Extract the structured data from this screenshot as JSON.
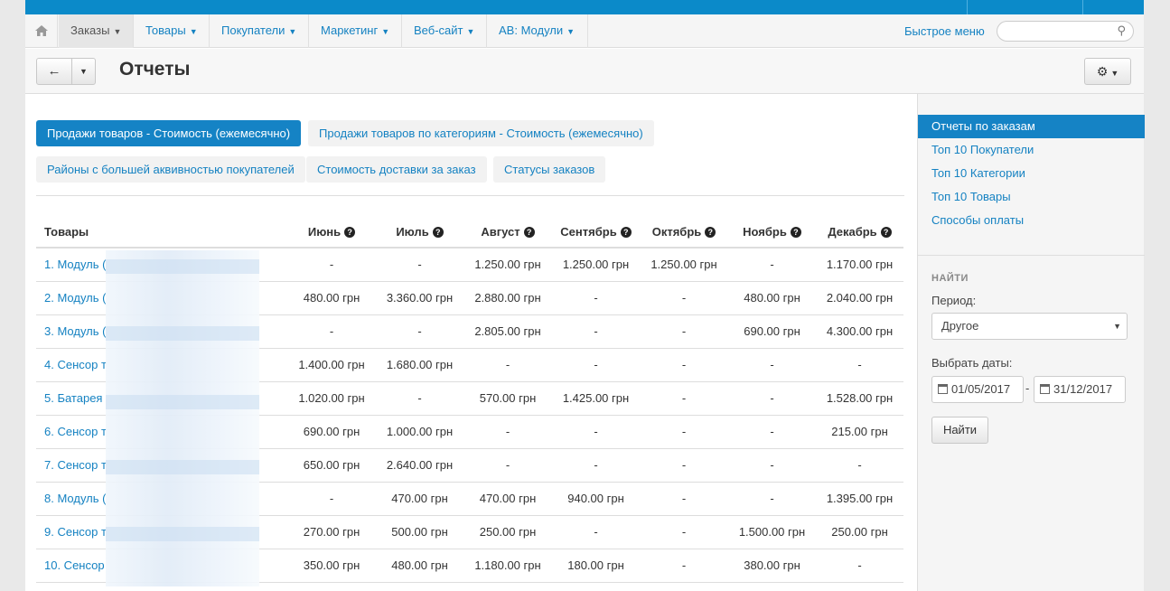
{
  "nav": {
    "items": [
      {
        "label": "Заказы",
        "active": true
      },
      {
        "label": "Товары",
        "active": false
      },
      {
        "label": "Покупатели",
        "active": false
      },
      {
        "label": "Маркетинг",
        "active": false
      },
      {
        "label": "Веб-сайт",
        "active": false
      },
      {
        "label": "AB: Модули",
        "active": false
      }
    ],
    "quick_menu": "Быстрое меню",
    "search_placeholder": ""
  },
  "header": {
    "title": "Отчеты"
  },
  "report_tabs": [
    {
      "label": "Продажи товаров - Стоимость (ежемесячно)",
      "active": true
    },
    {
      "label": "Продажи товаров по категориям - Стоимость (ежемесячно)",
      "active": false
    },
    {
      "label": "Районы с большей аквивностью покупателей",
      "active": false
    },
    {
      "label": "Стоимость доставки за заказ",
      "active": false
    },
    {
      "label": "Статусы заказов",
      "active": false
    }
  ],
  "table": {
    "columns": [
      "Товары",
      "Июнь",
      "Июль",
      "Август",
      "Сентябрь",
      "Октябрь",
      "Ноябрь",
      "Декабрь"
    ],
    "rows": [
      [
        "1. Модуль (",
        "-",
        "-",
        "1.250.00 грн",
        "1.250.00 грн",
        "1.250.00 грн",
        "-",
        "1.170.00 грн"
      ],
      [
        "2. Модуль (",
        "480.00 грн",
        "3.360.00 грн",
        "2.880.00 грн",
        "-",
        "-",
        "480.00 грн",
        "2.040.00 грн"
      ],
      [
        "3. Модуль (",
        "-",
        "-",
        "2.805.00 грн",
        "-",
        "-",
        "690.00 грн",
        "4.300.00 грн"
      ],
      [
        "4. Сенсор т",
        "1.400.00 грн",
        "1.680.00 грн",
        "-",
        "-",
        "-",
        "-",
        "-"
      ],
      [
        "5. Батарея",
        "1.020.00 грн",
        "-",
        "570.00 грн",
        "1.425.00 грн",
        "-",
        "-",
        "1.528.00 грн"
      ],
      [
        "6. Сенсор т",
        "690.00 грн",
        "1.000.00 грн",
        "-",
        "-",
        "-",
        "-",
        "215.00 грн"
      ],
      [
        "7. Сенсор т",
        "650.00 грн",
        "2.640.00 грн",
        "-",
        "-",
        "-",
        "-",
        "-"
      ],
      [
        "8. Модуль (",
        "-",
        "470.00 грн",
        "470.00 грн",
        "940.00 грн",
        "-",
        "-",
        "1.395.00 грн"
      ],
      [
        "9. Сенсор т",
        "270.00 грн",
        "500.00 грн",
        "250.00 грн",
        "-",
        "-",
        "1.500.00 грн",
        "250.00 грн"
      ],
      [
        "10. Сенсор",
        "350.00 грн",
        "480.00 грн",
        "1.180.00 грн",
        "180.00 грн",
        "-",
        "380.00 грн",
        "-"
      ]
    ]
  },
  "sidebar": {
    "links": [
      {
        "label": "Отчеты по заказам",
        "active": true
      },
      {
        "label": "Топ 10 Покупатели",
        "active": false
      },
      {
        "label": "Топ 10 Категории",
        "active": false
      },
      {
        "label": "Топ 10 Товары",
        "active": false
      },
      {
        "label": "Способы оплаты",
        "active": false
      }
    ],
    "find_title": "НАЙТИ",
    "period_label": "Период:",
    "period_value": "Другое",
    "dates_label": "Выбрать даты:",
    "date_from": "01/05/2017",
    "date_to": "31/12/2017",
    "find_button": "Найти"
  },
  "colors": {
    "accent": "#1583c5",
    "link": "#1582c2",
    "topbar": "#0b8ac9"
  }
}
